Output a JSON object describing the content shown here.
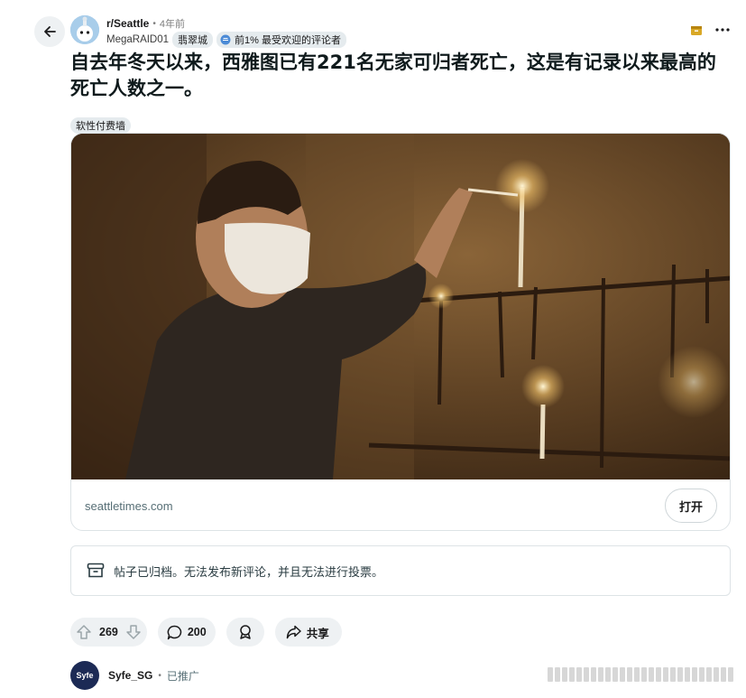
{
  "header": {
    "subreddit": "r/Seattle",
    "time_ago": "4年前",
    "username": "MegaRAID01",
    "user_flair": "翡翠城",
    "top_badge": "前1% 最受欢迎的评论者"
  },
  "post": {
    "title": "自去年冬天以来，西雅图已有221名无家可归者死亡，这是有记录以来最高的死亡人数之一。",
    "flair": "软性付费墙"
  },
  "link_card": {
    "domain": "seattletimes.com",
    "open_label": "打开"
  },
  "archived_notice": "帖子已归档。无法发布新评论，并且无法进行投票。",
  "actions": {
    "votes": "269",
    "comments": "200",
    "share_label": "共享"
  },
  "promoted": {
    "avatar_text": "Syfe",
    "name": "Syfe_SG",
    "tag": "已推广"
  },
  "icons": {
    "back": "arrow-left-icon",
    "upvote": "arrow-up-icon",
    "downvote": "arrow-down-icon",
    "comment": "speech-bubble-icon",
    "award": "award-icon",
    "share": "share-arrow-icon",
    "archive": "archive-box-icon",
    "more": "more-dots-icon"
  },
  "colors": {
    "accent_gold": "#d9a826",
    "pill_bg": "#eef1f3",
    "border": "#dde3e6"
  }
}
